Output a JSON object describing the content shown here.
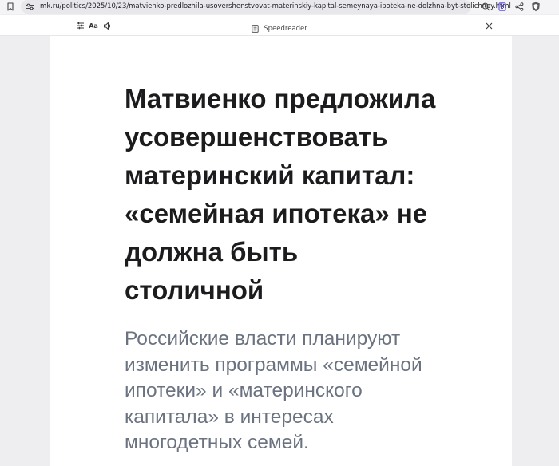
{
  "browser": {
    "url": "mk.ru/politics/2025/10/23/matvienko-predlozhila-usovershenstvovat-materinskiy-kapital-semeynaya-ipoteka-ne-dolzhna-byt-stolichnoy.html",
    "icons": [
      "bookmark-icon",
      "site-settings-icon",
      "zoom-icon",
      "speedreader-icon",
      "share-icon",
      "brave-shield-icon"
    ]
  },
  "toolbar": {
    "title": "Speedreader",
    "font_button_label": "Aa",
    "icons": [
      "settings-sliders-icon",
      "font-size-icon",
      "tts-icon",
      "speedreader-doc-icon",
      "close-icon"
    ]
  },
  "article": {
    "headline_lines": [
      "Матвиенко предложила",
      "усовершенствовать",
      "материнский капитал:",
      "«семейная ипотека» не",
      "должна быть",
      "столичной"
    ],
    "lead": "Российские власти планируют изменить программы «семейной ипотеки» и «материнского капитала» в интересах многодетных семей."
  },
  "colors": {
    "headline": "#1c1c1e",
    "lead": "#6b7280",
    "page_bg": "#eeeef0",
    "sheet_bg": "#ffffff"
  }
}
